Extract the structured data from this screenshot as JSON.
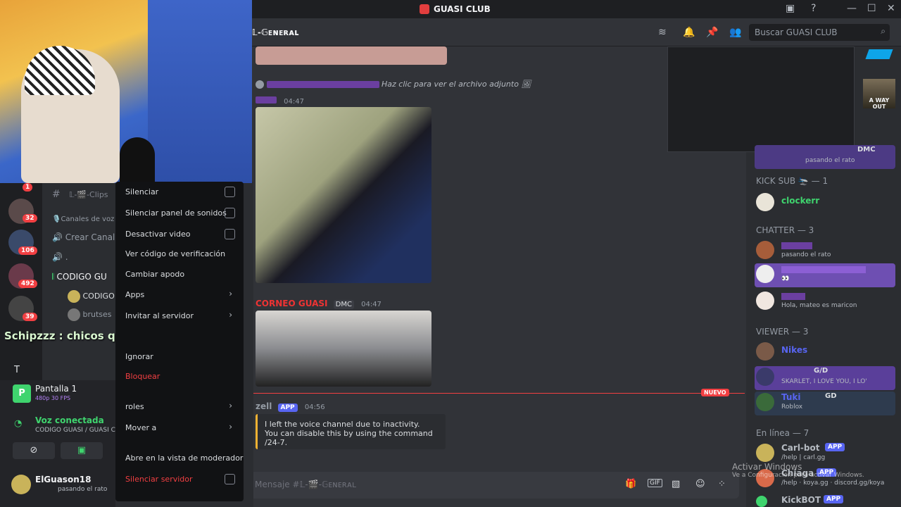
{
  "window": {
    "title": "GUASI CLUB"
  },
  "header": {
    "channel": "𝕃-𝔾ᴇɴᴇʀᴀʟ",
    "search_placeholder": "Buscar GUASI CLUB"
  },
  "stream_overlay": {
    "chat_text": "Schipzzz : chicos que es"
  },
  "messages": {
    "attachment_text": "Haz clic para ver el archivo adjunto",
    "msg1_time": "04:47",
    "msg2_author": "CORNEO GUASI",
    "msg2_tag": "DMC",
    "msg2_time": "04:47",
    "new_label": "NUEVO",
    "bot_name": "zell",
    "bot_tag": "APP",
    "bot_time": "04:56",
    "bot_line1": "I left the voice channel due to inactivity.",
    "bot_line2": "You can disable this by using the command /24-7."
  },
  "sidebar": {
    "clips_channel": "𝕃-🎬-Clips",
    "voice_category": "🎙️Canales de voz",
    "create_channel": "Crear Canal",
    "dot_channel": ".",
    "voice_channel": "CODIGO GU",
    "voice_user1": "CODIGO",
    "voice_user2": "brutses",
    "section_letter": "T",
    "screen_title": "Pantalla 1",
    "screen_quality": "480p 30 FPS",
    "voice_status": "Voz conectada",
    "voice_location": "CODIGO GUASI / GUASI CL",
    "username": "ElGuason18",
    "user_status": "pasando el rato"
  },
  "guild_badges": [
    "1",
    "32",
    "106",
    "492",
    "39"
  ],
  "context_menu": {
    "items": [
      "Silenciar",
      "Silenciar panel de sonidos",
      "Desactivar video",
      "Ver código de verificación",
      "Cambiar apodo",
      "Apps",
      "Invitar al servidor",
      "Ignorar",
      "Bloquear",
      "roles",
      "Mover a",
      "Abre en la vista de moderador",
      "Silenciar servidor"
    ]
  },
  "members": {
    "top_tag": "DMC",
    "top_status": "pasando el rato",
    "kick_sub": "KICK SUB 🛬 — 1",
    "clockerr": "clockerr",
    "chatter": "CHATTER — 3",
    "chatter1_status": "pasando el rato",
    "chatter2_status": "👀",
    "chatter3_status": "Hola, mateo es maricon",
    "viewer": "VIEWER — 3",
    "viewer1": "Nikes",
    "viewer2_tag": "G/D",
    "viewer2_status": "SKARLET, I LOVE YOU, I LO'",
    "viewer3": "Tuki",
    "viewer3_tag": "GD",
    "viewer3_status": "Roblox",
    "online": "En línea — 7",
    "bot1": "Carl-bot",
    "bot1_status": "/help | carl.gg",
    "bot2": "Chiaga",
    "bot2_status": "/help · koya.gg · discord.gg/koya",
    "bot3": "KickBOT",
    "app_tag": "APP",
    "watermark_title": "Activar Windows",
    "watermark_sub": "Ve a Configuración para activar Windows."
  },
  "input": {
    "placeholder": "Mensaje #𝕃-🎬-𝔾ᴇɴᴇʀᴀʟ"
  },
  "thumb_label": "A WAY OUT"
}
